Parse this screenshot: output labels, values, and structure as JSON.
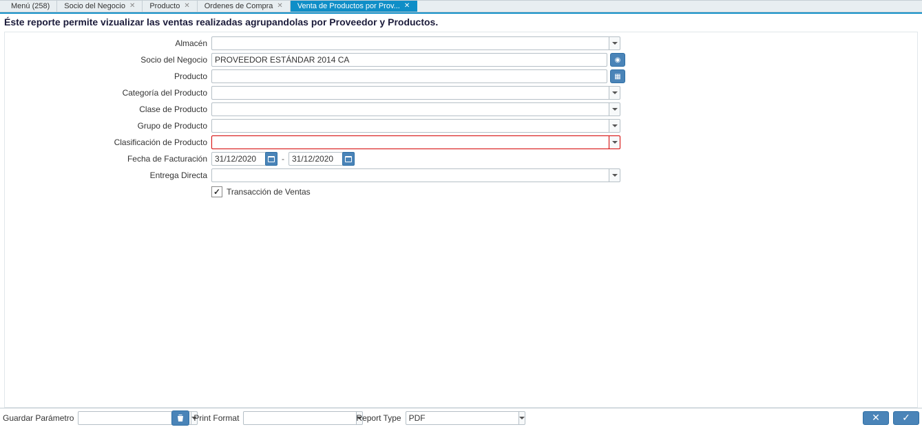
{
  "tabs": [
    {
      "label": "Menú (258)",
      "closable": false,
      "active": false
    },
    {
      "label": "Socio del Negocio",
      "closable": true,
      "active": false
    },
    {
      "label": "Producto",
      "closable": true,
      "active": false
    },
    {
      "label": "Ordenes de Compra",
      "closable": true,
      "active": false
    },
    {
      "label": "Venta de Productos por Prov...",
      "closable": true,
      "active": true
    }
  ],
  "description": "Éste reporte permite vizualizar las ventas realizadas agrupandolas por Proveedor y Productos.",
  "form": {
    "almacen": {
      "label": "Almacén",
      "value": ""
    },
    "socio_negocio": {
      "label": "Socio del Negocio",
      "value": "PROVEEDOR ESTÁNDAR 2014 CA"
    },
    "producto": {
      "label": "Producto",
      "value": ""
    },
    "categoria_producto": {
      "label": "Categoría del Producto",
      "value": ""
    },
    "clase_producto": {
      "label": "Clase de Producto",
      "value": ""
    },
    "grupo_producto": {
      "label": "Grupo de Producto",
      "value": ""
    },
    "clasificacion_producto": {
      "label": "Clasificación de Producto",
      "value": ""
    },
    "fecha_facturacion": {
      "label": "Fecha de Facturación",
      "from": "31/12/2020",
      "to": "31/12/2020",
      "sep": "-"
    },
    "entrega_directa": {
      "label": "Entrega Directa",
      "value": ""
    },
    "transaccion_ventas": {
      "label": "Transacción de Ventas",
      "checked": true
    }
  },
  "footer": {
    "guardar_parametro": {
      "label": "Guardar Parámetro",
      "value": ""
    },
    "print_format": {
      "label": "Print Format",
      "value": ""
    },
    "report_type": {
      "label": "Report Type",
      "value": "PDF"
    }
  }
}
